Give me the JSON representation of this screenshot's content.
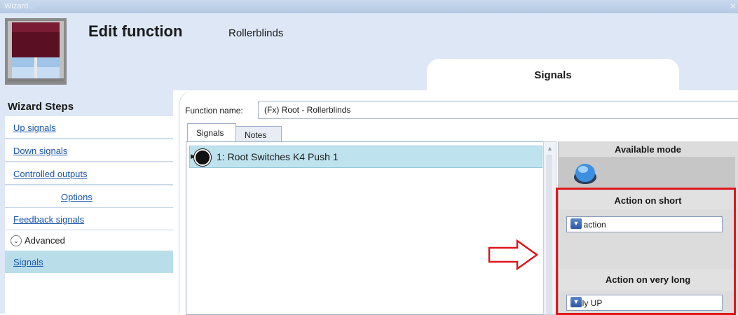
{
  "window": {
    "title": "Wizard...",
    "close_glyph": "✕"
  },
  "header": {
    "title": "Edit function",
    "subtitle": "Rollerblinds",
    "active_tab": "Signals",
    "icon": "rollerblind-icon"
  },
  "sidebar": {
    "title": "Wizard Steps",
    "items": [
      {
        "label": "Up signals"
      },
      {
        "label": "Down signals"
      },
      {
        "label": "Controlled outputs"
      },
      {
        "label": "Options"
      },
      {
        "label": "Feedback signals"
      }
    ],
    "advanced_label": "Advanced",
    "selected": "Signals"
  },
  "main": {
    "function_name_label": "Function name:",
    "function_name_value": "(Fx) Root - Rollerblinds",
    "tabs": [
      {
        "label": "Signals"
      },
      {
        "label": "Notes"
      }
    ],
    "signals": [
      {
        "label": "1: Root Switches K4 Push 1"
      }
    ]
  },
  "right_panel": {
    "available_mode": "Available mode",
    "action_short_label": "Action on short",
    "action_short_value": "No action",
    "action_verylong_label": "Action on very long",
    "action_verylong_value": "Fully UP"
  },
  "colors": {
    "highlight": "#e0161b",
    "selection": "#bfe3ee",
    "header_bg": "#dde7f5"
  }
}
